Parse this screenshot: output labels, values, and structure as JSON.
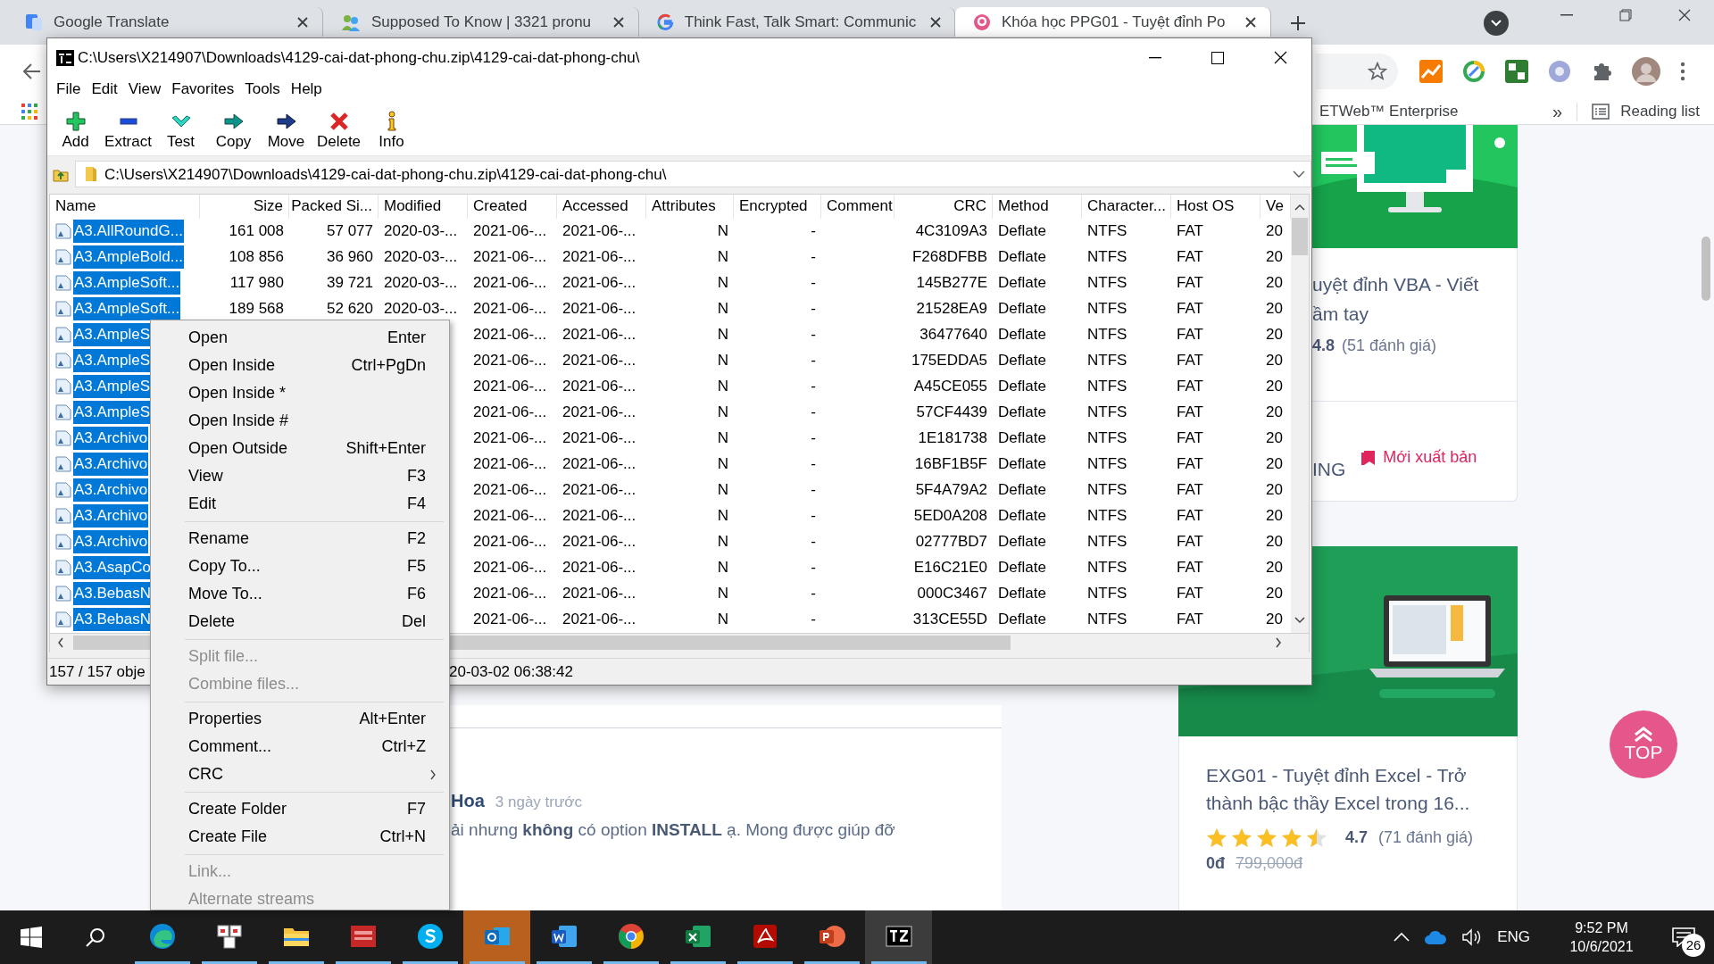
{
  "browser": {
    "tabs": [
      {
        "title": "Google Translate",
        "kind": "translate",
        "selected": false
      },
      {
        "title": "Supposed To Know | 3321 pronu",
        "kind": "people",
        "selected": false
      },
      {
        "title": "Think Fast, Talk Smart: Communic",
        "kind": "g",
        "selected": false
      },
      {
        "title": "Khóa học PPG01 - Tuyệt đỉnh Po",
        "kind": "brand",
        "selected": true
      }
    ],
    "bookmark": "ETWeb™ Enterprise",
    "more": "»",
    "reading_list": "Reading list"
  },
  "page": {
    "comment": {
      "author": "Hoa",
      "time": "3 ngày trước",
      "text": "ải nhưng **không** có option **INSTALL** ạ. Mong được giúp đỡ"
    },
    "course_1": {
      "title_lines": [
        "uyệt đỉnh VBA - Viết",
        "ầm tay"
      ],
      "rating": "4.8",
      "rating_count": "(51 đánh giá)",
      "tag": "ING",
      "badge": "Mới xuất bản"
    },
    "course_2": {
      "title": "EXG01 - Tuyệt đỉnh Excel - Trở thành bậc thầy Excel trong 16...",
      "stars": 4.5,
      "rating": "4.7",
      "rating_count": "(71 đánh giá)",
      "price": "0đ",
      "old_price": "799,000đ"
    },
    "top_button": "TOP"
  },
  "archive_window": {
    "title": "C:\\Users\\X214907\\Downloads\\4129-cai-dat-phong-chu.zip\\4129-cai-dat-phong-chu\\",
    "menu": [
      "File",
      "Edit",
      "View",
      "Favorites",
      "Tools",
      "Help"
    ],
    "toolbar": [
      {
        "label": "Add",
        "kind": "add"
      },
      {
        "label": "Extract",
        "kind": "extract"
      },
      {
        "label": "Test",
        "kind": "test"
      },
      {
        "label": "Copy",
        "kind": "copy"
      },
      {
        "label": "Move",
        "kind": "move"
      },
      {
        "label": "Delete",
        "kind": "delete"
      },
      {
        "label": "Info",
        "kind": "info"
      }
    ],
    "address": "C:\\Users\\X214907\\Downloads\\4129-cai-dat-phong-chu.zip\\4129-cai-dat-phong-chu\\",
    "columns": [
      "Name",
      "Size",
      "Packed Si...",
      "Modified",
      "Created",
      "Accessed",
      "Attributes",
      "Encrypted",
      "Comment",
      "CRC",
      "Method",
      "Character...",
      "Host OS",
      "Ve"
    ],
    "rows": [
      {
        "name": "A3.AllRoundG...",
        "size": "161 008",
        "packed": "57 077",
        "modified": "2020-03-...",
        "created": "2021-06-...",
        "accessed": "2021-06-...",
        "attributes": "N",
        "encrypted": "-",
        "crc": "4C3109A3",
        "method": "Deflate",
        "characteristics": "NTFS",
        "host_os": "FAT",
        "version": "20",
        "selected": true
      },
      {
        "name": "A3.AmpleBold...",
        "size": "108 856",
        "packed": "36 960",
        "modified": "2020-03-...",
        "created": "2021-06-...",
        "accessed": "2021-06-...",
        "attributes": "N",
        "encrypted": "-",
        "crc": "F268DFBB",
        "method": "Deflate",
        "characteristics": "NTFS",
        "host_os": "FAT",
        "version": "20",
        "selected": true
      },
      {
        "name": "A3.AmpleSoft...",
        "size": "117 980",
        "packed": "39 721",
        "modified": "2020-03-...",
        "created": "2021-06-...",
        "accessed": "2021-06-...",
        "attributes": "N",
        "encrypted": "-",
        "crc": "145B277E",
        "method": "Deflate",
        "characteristics": "NTFS",
        "host_os": "FAT",
        "version": "20",
        "selected": true
      },
      {
        "name": "A3.AmpleSoft...",
        "size": "189 568",
        "packed": "52 620",
        "modified": "2020-03-...",
        "created": "2021-06-...",
        "accessed": "2021-06-...",
        "attributes": "N",
        "encrypted": "-",
        "crc": "21528EA9",
        "method": "Deflate",
        "characteristics": "NTFS",
        "host_os": "FAT",
        "version": "20",
        "selected": true
      },
      {
        "name": "A3.AmpleS",
        "created": "2021-06-...",
        "accessed": "2021-06-...",
        "attributes": "N",
        "encrypted": "-",
        "crc": "36477640",
        "method": "Deflate",
        "characteristics": "NTFS",
        "host_os": "FAT",
        "version": "20",
        "selected": true
      },
      {
        "name": "A3.AmpleS",
        "created": "2021-06-...",
        "accessed": "2021-06-...",
        "attributes": "N",
        "encrypted": "-",
        "crc": "175EDDA5",
        "method": "Deflate",
        "characteristics": "NTFS",
        "host_os": "FAT",
        "version": "20",
        "selected": true
      },
      {
        "name": "A3.AmpleS",
        "created": "2021-06-...",
        "accessed": "2021-06-...",
        "attributes": "N",
        "encrypted": "-",
        "crc": "A45CE055",
        "method": "Deflate",
        "characteristics": "NTFS",
        "host_os": "FAT",
        "version": "20",
        "selected": true
      },
      {
        "name": "A3.AmpleS",
        "created": "2021-06-...",
        "accessed": "2021-06-...",
        "attributes": "N",
        "encrypted": "-",
        "crc": "57CF4439",
        "method": "Deflate",
        "characteristics": "NTFS",
        "host_os": "FAT",
        "version": "20",
        "selected": true
      },
      {
        "name": "A3.Archivo",
        "created": "2021-06-...",
        "accessed": "2021-06-...",
        "attributes": "N",
        "encrypted": "-",
        "crc": "1E181738",
        "method": "Deflate",
        "characteristics": "NTFS",
        "host_os": "FAT",
        "version": "20",
        "selected": true
      },
      {
        "name": "A3.Archivo",
        "created": "2021-06-...",
        "accessed": "2021-06-...",
        "attributes": "N",
        "encrypted": "-",
        "crc": "16BF1B5F",
        "method": "Deflate",
        "characteristics": "NTFS",
        "host_os": "FAT",
        "version": "20",
        "selected": true
      },
      {
        "name": "A3.Archivo",
        "created": "2021-06-...",
        "accessed": "2021-06-...",
        "attributes": "N",
        "encrypted": "-",
        "crc": "5F4A79A2",
        "method": "Deflate",
        "characteristics": "NTFS",
        "host_os": "FAT",
        "version": "20",
        "selected": true
      },
      {
        "name": "A3.Archivo",
        "created": "2021-06-...",
        "accessed": "2021-06-...",
        "attributes": "N",
        "encrypted": "-",
        "crc": "5ED0A208",
        "method": "Deflate",
        "characteristics": "NTFS",
        "host_os": "FAT",
        "version": "20",
        "selected": true
      },
      {
        "name": "A3.Archivo",
        "created": "2021-06-...",
        "accessed": "2021-06-...",
        "attributes": "N",
        "encrypted": "-",
        "crc": "02777BD7",
        "method": "Deflate",
        "characteristics": "NTFS",
        "host_os": "FAT",
        "version": "20",
        "selected": true
      },
      {
        "name": "A3.AsapCo",
        "created": "2021-06-...",
        "accessed": "2021-06-...",
        "attributes": "N",
        "encrypted": "-",
        "crc": "E16C21E0",
        "method": "Deflate",
        "characteristics": "NTFS",
        "host_os": "FAT",
        "version": "20",
        "selected": true
      },
      {
        "name": "A3.BebasN",
        "created": "2021-06-...",
        "accessed": "2021-06-...",
        "attributes": "N",
        "encrypted": "-",
        "crc": "000C3467",
        "method": "Deflate",
        "characteristics": "NTFS",
        "host_os": "FAT",
        "version": "20",
        "selected": true
      },
      {
        "name": "A3.BebasN",
        "created": "2021-06-...",
        "accessed": "2021-06-...",
        "attributes": "N",
        "encrypted": "-",
        "crc": "313CE55D",
        "method": "Deflate",
        "characteristics": "NTFS",
        "host_os": "FAT",
        "version": "20",
        "selected": true
      }
    ],
    "status": [
      "157 / 157 obje",
      "20-03-02 06:38:42"
    ]
  },
  "context_menu": {
    "items": [
      {
        "kind": "item",
        "label": "Open",
        "shortcut": "Enter",
        "disabled": false
      },
      {
        "kind": "item",
        "label": "Open Inside",
        "shortcut": "Ctrl+PgDn",
        "disabled": false
      },
      {
        "kind": "item",
        "label": "Open Inside *",
        "disabled": false
      },
      {
        "kind": "item",
        "label": "Open Inside #",
        "disabled": false
      },
      {
        "kind": "item",
        "label": "Open Outside",
        "shortcut": "Shift+Enter",
        "disabled": false
      },
      {
        "kind": "item",
        "label": "View",
        "shortcut": "F3",
        "disabled": false
      },
      {
        "kind": "item",
        "label": "Edit",
        "shortcut": "F4",
        "disabled": false
      },
      {
        "kind": "separator"
      },
      {
        "kind": "item",
        "label": "Rename",
        "shortcut": "F2",
        "disabled": false
      },
      {
        "kind": "item",
        "label": "Copy To...",
        "shortcut": "F5",
        "disabled": false
      },
      {
        "kind": "item",
        "label": "Move To...",
        "shortcut": "F6",
        "disabled": false
      },
      {
        "kind": "item",
        "label": "Delete",
        "shortcut": "Del",
        "disabled": false
      },
      {
        "kind": "separator"
      },
      {
        "kind": "item",
        "label": "Split file...",
        "disabled": true
      },
      {
        "kind": "item",
        "label": "Combine files...",
        "disabled": true
      },
      {
        "kind": "separator"
      },
      {
        "kind": "item",
        "label": "Properties",
        "shortcut": "Alt+Enter",
        "disabled": false
      },
      {
        "kind": "item",
        "label": "Comment...",
        "shortcut": "Ctrl+Z",
        "disabled": false
      },
      {
        "kind": "submenu",
        "label": "CRC",
        "disabled": false
      },
      {
        "kind": "separator"
      },
      {
        "kind": "item",
        "label": "Create Folder",
        "shortcut": "F7",
        "disabled": false
      },
      {
        "kind": "item",
        "label": "Create File",
        "shortcut": "Ctrl+N",
        "disabled": false
      },
      {
        "kind": "separator"
      },
      {
        "kind": "item",
        "label": "Link...",
        "disabled": true
      },
      {
        "kind": "item",
        "label": "Alternate streams",
        "disabled": true
      }
    ]
  },
  "taskbar": {
    "apps": [
      {
        "kind": "edge",
        "flashing": false,
        "focused": false
      },
      {
        "kind": "keys",
        "flashing": false,
        "focused": false
      },
      {
        "kind": "folder",
        "flashing": false,
        "focused": false
      },
      {
        "kind": "avaya",
        "flashing": false,
        "focused": false
      },
      {
        "kind": "skype",
        "flashing": false,
        "focused": false
      },
      {
        "kind": "outlook",
        "flashing": true,
        "focused": false
      },
      {
        "kind": "word",
        "flashing": false,
        "focused": false
      },
      {
        "kind": "chrome",
        "flashing": false,
        "focused": false
      },
      {
        "kind": "excel",
        "flashing": false,
        "focused": false
      },
      {
        "kind": "acrobat",
        "flashing": false,
        "focused": false
      },
      {
        "kind": "powerpoint",
        "flashing": false,
        "focused": false
      },
      {
        "kind": "sevenzip",
        "flashing": false,
        "focused": true
      }
    ],
    "language": "ENG",
    "time": "9:52 PM",
    "date": "10/6/2021",
    "notifications": "26"
  }
}
